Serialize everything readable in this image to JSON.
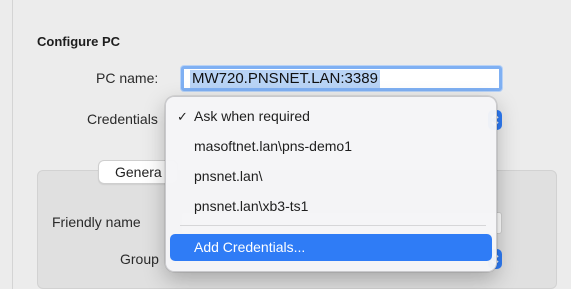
{
  "dialog": {
    "title": "Configure PC",
    "pc_name_label": "PC name:",
    "pc_name_value": "MW720.PNSNET.LAN:3389",
    "credentials_label": "Credentials",
    "tabs": [
      "Genera"
    ],
    "friendly_name_label": "Friendly name",
    "group_label": "Group"
  },
  "credentials_menu": {
    "selected_value": "Ask when required",
    "items": [
      "Ask when required",
      "masoftnet.lan\\pns-demo1",
      "pnsnet.lan\\",
      "pnsnet.lan\\xb3-ts1",
      "Add Credentials..."
    ],
    "highlighted_item": "Add Credentials..."
  },
  "icons": {
    "checkmark": "checkmark-icon",
    "popup_arrows": "chevron-up-down-icon"
  },
  "colors": {
    "accent": "#2f7cf6",
    "focus_ring": "#7fb0f3",
    "selection": "#b9d4f6"
  }
}
